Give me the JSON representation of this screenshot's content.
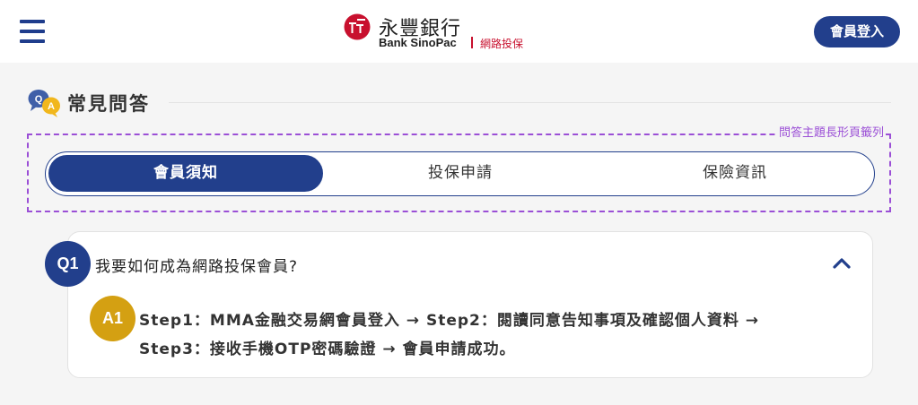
{
  "header": {
    "menu_icon": "hamburger-menu-icon",
    "logo": {
      "name_zh": "永豐銀行",
      "name_en": "Bank SinoPac",
      "subtitle": "網路投保",
      "brand_color": "#c8102e"
    },
    "login_label": "會員登入"
  },
  "faq": {
    "title": "常見問答",
    "icon": "qa-chat-icon",
    "tab_frame_label": "問答主題長形頁籤列",
    "tabs": [
      {
        "label": "會員須知",
        "active": true
      },
      {
        "label": "投保申請",
        "active": false
      },
      {
        "label": "保險資訊",
        "active": false
      }
    ],
    "items": [
      {
        "q_badge": "Q1",
        "question": "我要如何成為網路投保會員?",
        "expanded": true,
        "a_badge": "A1",
        "answer_line1": "Step1：MMA金融交易網會員登入 → Step2：閱讀同意告知事項及確認個人資料 →",
        "answer_line2": "Step3：接收手機OTP密碼驗證 → 會員申請成功。"
      }
    ]
  },
  "colors": {
    "primary": "#223f8c",
    "answer_badge": "#d4a012",
    "frame_dash": "#9b4fd6",
    "background": "#f5f5f5"
  }
}
